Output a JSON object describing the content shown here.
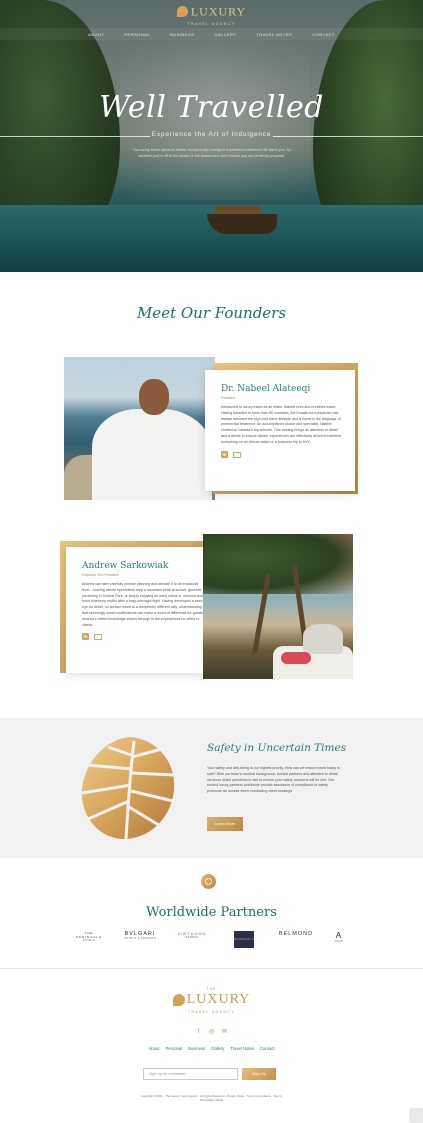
{
  "brand": {
    "the": "THE",
    "name": "LUXURY",
    "sub": "TRAVEL AGENCY"
  },
  "nav": [
    "About",
    "Personal",
    "Business",
    "Gallery",
    "Travel Notes",
    "Contact"
  ],
  "hero": {
    "title": "Well Travelled",
    "subtitle": "Experience the Art of Indulgence",
    "description": "Our luxury travel advisors deliver exceptionally indulgent experiences wherever life takes you. So whether you’re off to the beach or the boardroom, we’ll ensure you are perfectly prepared."
  },
  "founders": {
    "title": "Meet Our Founders",
    "people": [
      {
        "name": "Dr. Nabeel Alateeqi",
        "role": "President",
        "bio": "Introduced to luxury travel as an infant, Nabeel lives and breathes travel. Having travelled to more than 80 countries, the Kuwait-born physician has always favoured the high-end travel lifestyle and is fluent in the language of preferential treatment. An accomplished doctor and specialist, Nabeel studied at Canada’s top schools. This training brings an attention to detail and a desire to ensure clients’ experiences are effectively delivered whether embarking on an African safari or a business trip to NYC."
      },
      {
        "name": "Andrew Sarkowiak",
        "role": "Executive Vice President",
        "bio": "Andrew can take carefully precise planning and elevate it to an emotional level – leaving clients speechless atop a mountain peak at sunset, gourmet picnicking in Central Park, or simply enjoying an early check in, mimosa and fresh blueberry muffin after a long overnight flight. Having developed a keen eye for detail, no surface travel is a completely different way, understanding that seemingly small modifications can make a world of difference for guests. Andrew’s vetted knowledge shines through in the experiences he offers to clients."
      }
    ]
  },
  "safety": {
    "title": "Safety in Uncertain Times",
    "text": "Your safety and well-being is our highest priority. How can we ensure travel today is safe? With our team’s medical background, trusted partners and attention to detail, we know which questions to ask to ensure your safety concerns will be met. Our trusted luxury partners worldwide provide assurance of compliance to safety protocols we access when conducting client bookings.",
    "button": "Learn More"
  },
  "partners": {
    "title": "Worldwide Partners",
    "logos": [
      {
        "name": "THE PENINSULA",
        "sub": "HOTELS"
      },
      {
        "name": "BVLGARI",
        "sub": "HOTELS & RESORTS"
      },
      {
        "name": "VIRTUOSO",
        "sub": "MEMBER"
      },
      {
        "name": "MANDARIN",
        "sub": ""
      },
      {
        "name": "BELMOND",
        "sub": ""
      },
      {
        "name": "A",
        "sub": "AMAN"
      }
    ]
  },
  "footer": {
    "nav": [
      "About",
      "Personal",
      "Business",
      "Gallery",
      "Travel Notes",
      "Contact"
    ],
    "newsletter_placeholder": "Sign up for newsletter",
    "signup_label": "Sign Up",
    "copyright": "Copyright © 2021 · The Luxury Travel Agency · All Rights Reserved · Privacy Policy · Terms & Conditions · Site by Riverwalker Media"
  },
  "colors": {
    "teal": "#1e6e6b",
    "gold": "#c99a56",
    "background_section": "#f1f1f1"
  }
}
